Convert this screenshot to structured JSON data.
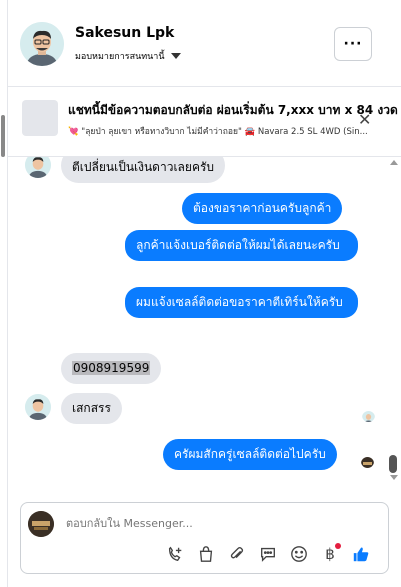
{
  "header": {
    "contact_name": "Sakesun Lpk",
    "subtitle": "มอบหมายการสนทนานี้",
    "more_label": "···"
  },
  "banner": {
    "title": "แชทนี้มีข้อความตอบกลับต่อ ผ่อนเริ่มต้น 7,xxx บาท x 84 งวด",
    "subtitle": "💘 \"ลุยป่า ลุยเขา หรือทางวิบาก ไม่มีคำว่าถอย\" 🚘 Navara 2.5 SL 4WD (Sin..."
  },
  "messages": [
    {
      "dir": "in",
      "text": "ตีเปลี่ยนเป็นเงินดาวเลยครับ"
    },
    {
      "dir": "out",
      "text": "ต้องขอราคาก่อนครับลูกค้า"
    },
    {
      "dir": "out",
      "text": "ลูกค้าแจ้งเบอร์ติดต่อให้ผมได้เลยนะครับ"
    },
    {
      "dir": "out",
      "text": "ผมแจ้งเซลล์ติดต่อขอราคาตีเทิร์นให้ครับ"
    },
    {
      "dir": "in",
      "text": "0908919599"
    },
    {
      "dir": "in",
      "text": "เสกสรร"
    },
    {
      "dir": "out",
      "text": "ครัผมสักครู่เซลล์ติดต่อไปครับ"
    }
  ],
  "composer": {
    "placeholder": "ตอบกลับใน Messenger..."
  },
  "colors": {
    "outgoing_bubble": "#0a7cff",
    "incoming_bubble": "#e4e6eb",
    "like_button": "#0a7cff"
  },
  "icons": [
    "chevron-down-icon",
    "more-icon",
    "close-icon",
    "add-contact-icon",
    "bag-icon",
    "attach-icon",
    "chat-bubble-icon",
    "emoji-icon",
    "baht-icon",
    "like-icon"
  ]
}
